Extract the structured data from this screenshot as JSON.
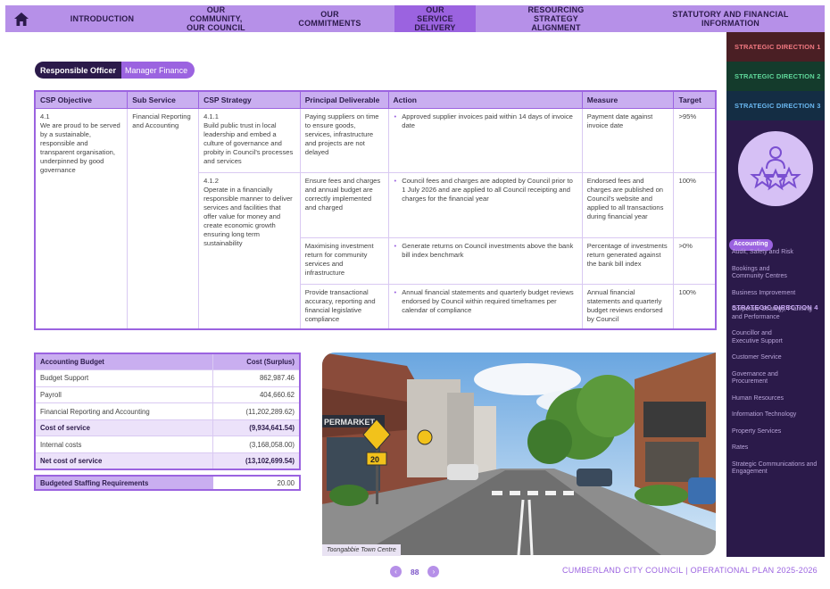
{
  "nav": {
    "items": [
      {
        "label": "INTRODUCTION"
      },
      {
        "label": "OUR COMMUNITY, OUR COUNCIL"
      },
      {
        "label": "OUR COMMITMENTS"
      },
      {
        "label": "OUR SERVICE DELIVERY"
      },
      {
        "label": "RESOURCING STRATEGY ALIGNMENT"
      },
      {
        "label": "STATUTORY AND FINANCIAL INFORMATION"
      }
    ],
    "active": "OUR SERVICE DELIVERY"
  },
  "sidebar": {
    "sd1": "STRATEGIC DIRECTION 1",
    "sd2": "STRATEGIC DIRECTION 2",
    "sd3": "STRATEGIC DIRECTION 3",
    "sd4": "STRATEGIC DIRECTION 4",
    "items": [
      "Accounting",
      "Audit, Safety and Risk",
      "Bookings and Community Centres",
      "Business Improvement",
      "Corporate Strategy, Planning and Performance",
      "Councillor and Executive Support",
      "Customer Service",
      "Governance and Procurement",
      "Human Resources",
      "Information Technology",
      "Property Services",
      "Rates",
      "Strategic Communications and Engagement"
    ],
    "active_item": "Accounting",
    "colors": {
      "sd1": "#4a1f24",
      "sd2": "#143b2c",
      "sd3": "#142d44",
      "sd4": "#2b1a4a"
    }
  },
  "officer": {
    "label": "Responsible Officer",
    "value": "Manager Finance"
  },
  "table": {
    "headers": [
      "CSP Objective",
      "Sub Service",
      "CSP Strategy",
      "Principal Deliverable",
      "Action",
      "Measure",
      "Target"
    ],
    "objective": "4.1\nWe are proud to be served by a sustainable, responsible and transparent organisation, underpinned by good governance",
    "sub_service": "Financial Reporting and Accounting",
    "strategies": [
      "4.1.1\nBuild public trust in local leadership and embed a culture of governance and probity in Council's processes and services",
      "4.1.2\nOperate in a financially responsible manner to deliver services and facilities that offer value for money and create economic growth ensuring long term sustainability"
    ],
    "rows": [
      {
        "deliverable": "Paying suppliers on time to ensure goods, services, infrastructure and projects are not delayed",
        "action": "Approved supplier invoices paid within 14 days of invoice date",
        "measure": "Payment date against invoice date",
        "target": ">95%"
      },
      {
        "deliverable": "Ensure fees and charges and annual budget are correctly implemented and charged",
        "action": "Council fees and charges are adopted by Council prior to 1 July 2026 and are applied to all Council receipting and charges for the financial year",
        "measure": "Endorsed fees and charges are published on Council's website and applied to all transactions during financial year",
        "target": "100%"
      },
      {
        "deliverable": "Maximising investment return for community services and infrastructure",
        "action": "Generate returns on Council investments above the bank bill index benchmark",
        "measure": "Percentage of investments return generated against the bank bill index",
        "target": ">0%"
      },
      {
        "deliverable": "Provide transactional accuracy, reporting and financial legislative compliance",
        "action": "Annual financial statements and quarterly budget reviews endorsed by Council within required timeframes per calendar of compliance",
        "measure": "Annual financial statements and quarterly budget reviews endorsed by Council",
        "target": "100%"
      }
    ]
  },
  "budget": {
    "headers": [
      "Accounting Budget",
      "Cost (Surplus)"
    ],
    "rows": [
      {
        "label": "Budget Support",
        "value": "862,987.46",
        "bold": false
      },
      {
        "label": "Payroll",
        "value": "404,660.62",
        "bold": false
      },
      {
        "label": "Financial Reporting and Accounting",
        "value": "(11,202,289.62)",
        "bold": false
      },
      {
        "label": "Cost of service",
        "value": "(9,934,641.54)",
        "bold": true
      },
      {
        "label": "Internal costs",
        "value": "(3,168,058.00)",
        "bold": false
      },
      {
        "label": "Net cost of service",
        "value": "(13,102,699.54)",
        "bold": true
      }
    ]
  },
  "staffing": {
    "label": "Budgeted Staffing Requirements",
    "value": "20.00"
  },
  "photo": {
    "caption": "Toongabbie Town Centre",
    "store_sign": "PERMARKET",
    "speed_sign": "20"
  },
  "footer": {
    "page": "88",
    "title": "CUMBERLAND CITY COUNCIL  |  OPERATIONAL PLAN 2025-2026"
  },
  "accent": "#9b63e0"
}
